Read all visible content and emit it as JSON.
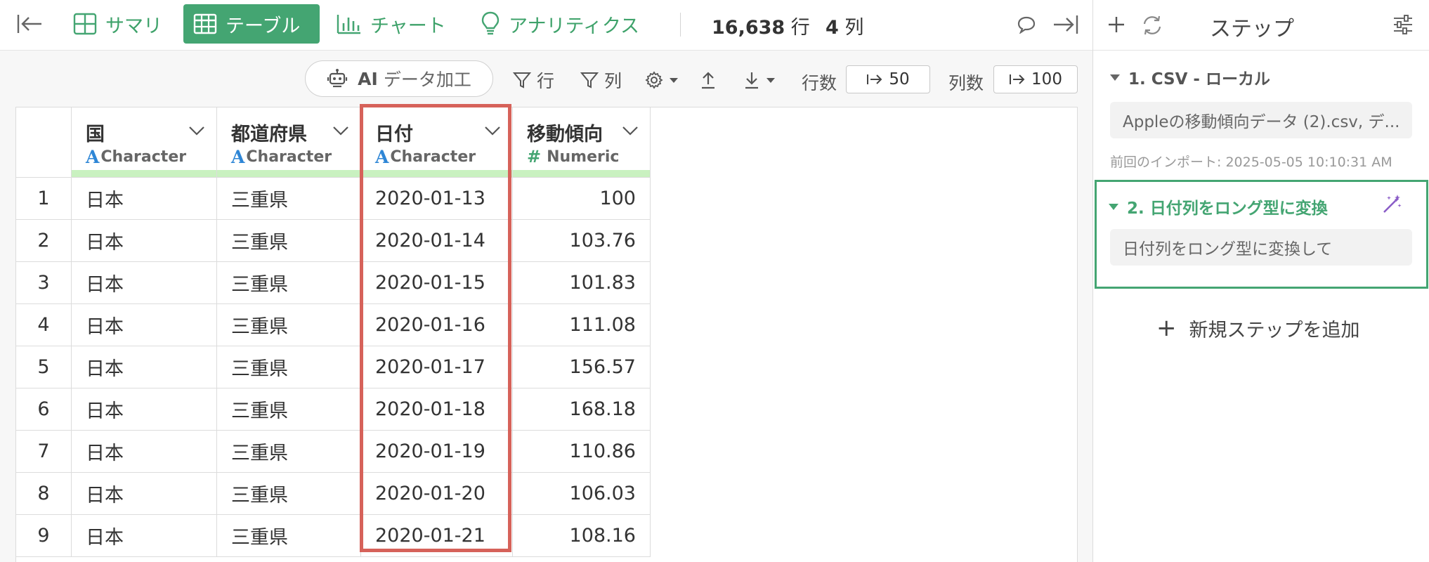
{
  "toolbar": {
    "tabs": [
      {
        "label": "サマリ",
        "icon": "grid-icon",
        "active": false
      },
      {
        "label": "テーブル",
        "icon": "table-icon",
        "active": true
      },
      {
        "label": "チャート",
        "icon": "bar-chart-icon",
        "active": false
      },
      {
        "label": "アナリティクス",
        "icon": "lightbulb-icon",
        "active": false
      }
    ],
    "row_count": "16,638",
    "row_unit": "行",
    "col_count": "4",
    "col_unit": "列"
  },
  "subtoolbar": {
    "ai_label": "AI",
    "ai_text": "データ加工",
    "filter_rows": "行",
    "filter_cols": "列",
    "rows_label": "行数",
    "rows_value": "50",
    "cols_label": "列数",
    "cols_value": "100"
  },
  "table": {
    "columns": [
      {
        "name": "国",
        "type": "Character"
      },
      {
        "name": "都道府県",
        "type": "Character"
      },
      {
        "name": "日付",
        "type": "Character"
      },
      {
        "name": "移動傾向",
        "type": "Numeric"
      }
    ],
    "rows": [
      {
        "n": "1",
        "country": "日本",
        "pref": "三重県",
        "date": "2020-01-13",
        "value": "100"
      },
      {
        "n": "2",
        "country": "日本",
        "pref": "三重県",
        "date": "2020-01-14",
        "value": "103.76"
      },
      {
        "n": "3",
        "country": "日本",
        "pref": "三重県",
        "date": "2020-01-15",
        "value": "101.83"
      },
      {
        "n": "4",
        "country": "日本",
        "pref": "三重県",
        "date": "2020-01-16",
        "value": "111.08"
      },
      {
        "n": "5",
        "country": "日本",
        "pref": "三重県",
        "date": "2020-01-17",
        "value": "156.57"
      },
      {
        "n": "6",
        "country": "日本",
        "pref": "三重県",
        "date": "2020-01-18",
        "value": "168.18"
      },
      {
        "n": "7",
        "country": "日本",
        "pref": "三重県",
        "date": "2020-01-19",
        "value": "110.86"
      },
      {
        "n": "8",
        "country": "日本",
        "pref": "三重県",
        "date": "2020-01-20",
        "value": "106.03"
      },
      {
        "n": "9",
        "country": "日本",
        "pref": "三重県",
        "date": "2020-01-21",
        "value": "108.16"
      }
    ]
  },
  "panel": {
    "title": "ステップ",
    "step1": {
      "title": "1. CSV - ローカル",
      "file": "Appleの移動傾向データ (2).csv, デ...",
      "meta": "前回のインポート: 2025-05-05 10:10:31 AM"
    },
    "step2": {
      "title": "2. 日付列をロング型に変換",
      "prompt": "日付列をロング型に変換して"
    },
    "add_step": "新規ステップを追加"
  },
  "colors": {
    "accent_green": "#44a572",
    "highlight_red": "#d6625a",
    "type_character_blue": "#2e86d6",
    "header_bar_green": "#c9f1c0"
  }
}
